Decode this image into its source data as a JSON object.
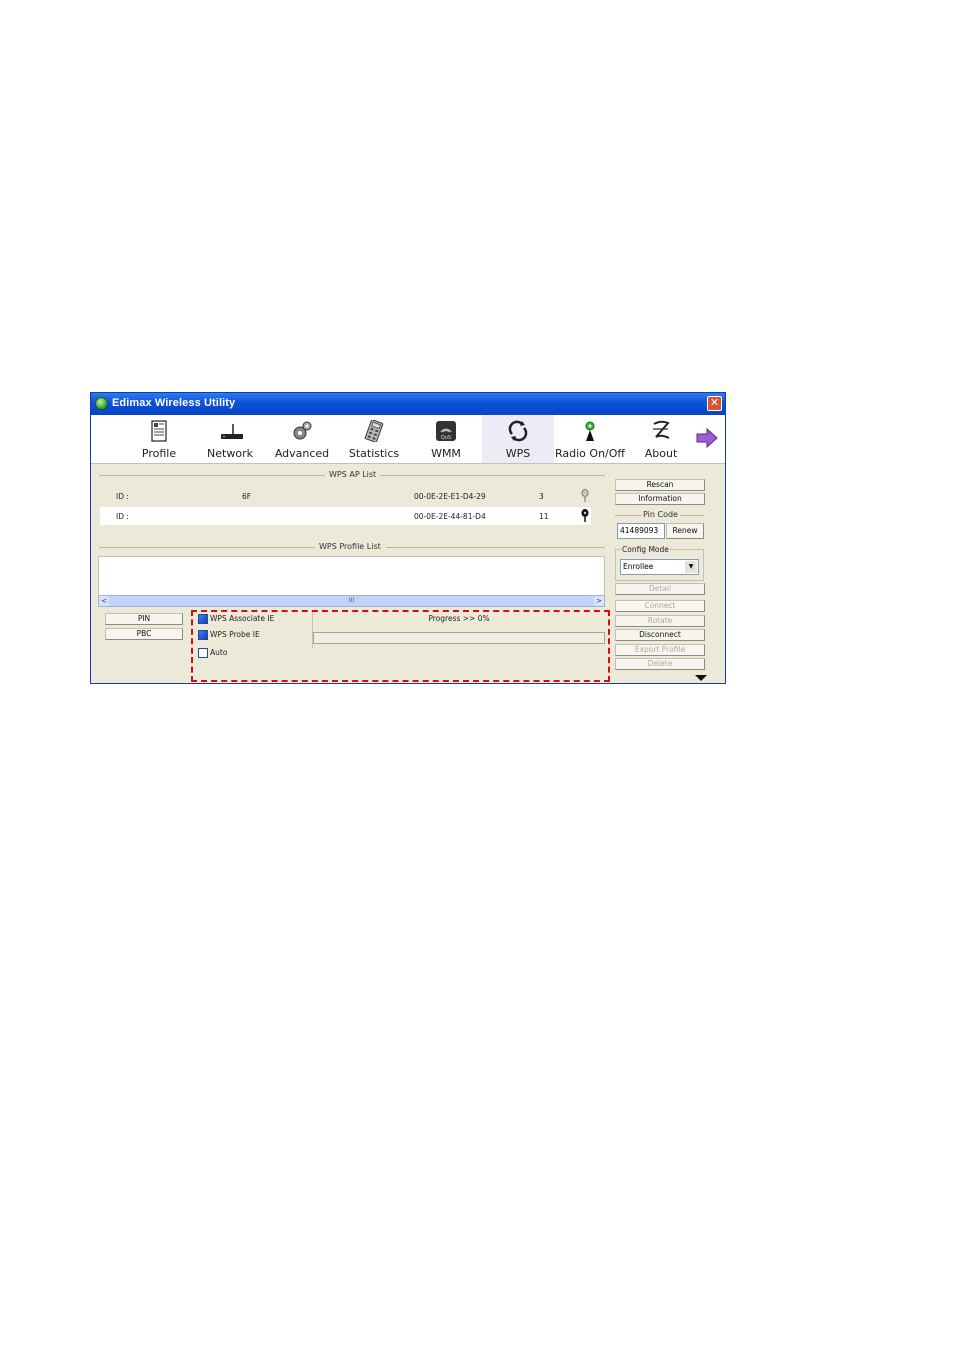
{
  "window": {
    "title": "Edimax Wireless Utility",
    "close_glyph": "✕"
  },
  "toolbar": {
    "items": [
      {
        "label": "Profile",
        "icon": "profile-document-icon"
      },
      {
        "label": "Network",
        "icon": "router-icon"
      },
      {
        "label": "Advanced",
        "icon": "gears-icon"
      },
      {
        "label": "Statistics",
        "icon": "calculator-icon"
      },
      {
        "label": "WMM",
        "icon": "qos-icon"
      },
      {
        "label": "WPS",
        "icon": "wps-icon",
        "active": true
      },
      {
        "label": "Radio On/Off",
        "icon": "radio-antenna-icon"
      },
      {
        "label": "About",
        "icon": "about-logo-icon"
      }
    ],
    "next_icon": "next-arrow-icon"
  },
  "wps_ap_list": {
    "title": "WPS AP List",
    "rows": [
      {
        "id_label": "ID :",
        "ssid": "6F",
        "bssid": "00-0E-2E-E1-D4-29",
        "channel": "3",
        "icon": "key-icon"
      },
      {
        "id_label": "ID :",
        "ssid": "",
        "bssid": "00-0E-2E-44-81-D4",
        "channel": "11",
        "icon": "key-icon"
      }
    ]
  },
  "wps_profile_list": {
    "title": "WPS Profile List",
    "scroll_grip": "III",
    "left_arrow": "<",
    "right_arrow": ">"
  },
  "side": {
    "rescan": "Rescan",
    "information": "Information",
    "pin_code_label": "Pin Code",
    "pin_code_value": "41489093",
    "renew": "Renew",
    "config_mode_label": "Config Mode",
    "config_mode_value": "Enrollee",
    "detail": "Detail",
    "connect": "Connect",
    "rotate": "Rotate",
    "disconnect": "Disconnect",
    "export_profile": "Export Profile",
    "delete": "Delete"
  },
  "bottom": {
    "pin": "PIN",
    "pbc": "PBC",
    "wps_associate_ie": "WPS Associate IE",
    "wps_probe_ie": "WPS Probe IE",
    "auto": "Auto",
    "progress": "Progress >> 0%",
    "progress_value": 0
  },
  "colors": {
    "highlight": "#d01010",
    "title_bar": "#0b52d6"
  }
}
